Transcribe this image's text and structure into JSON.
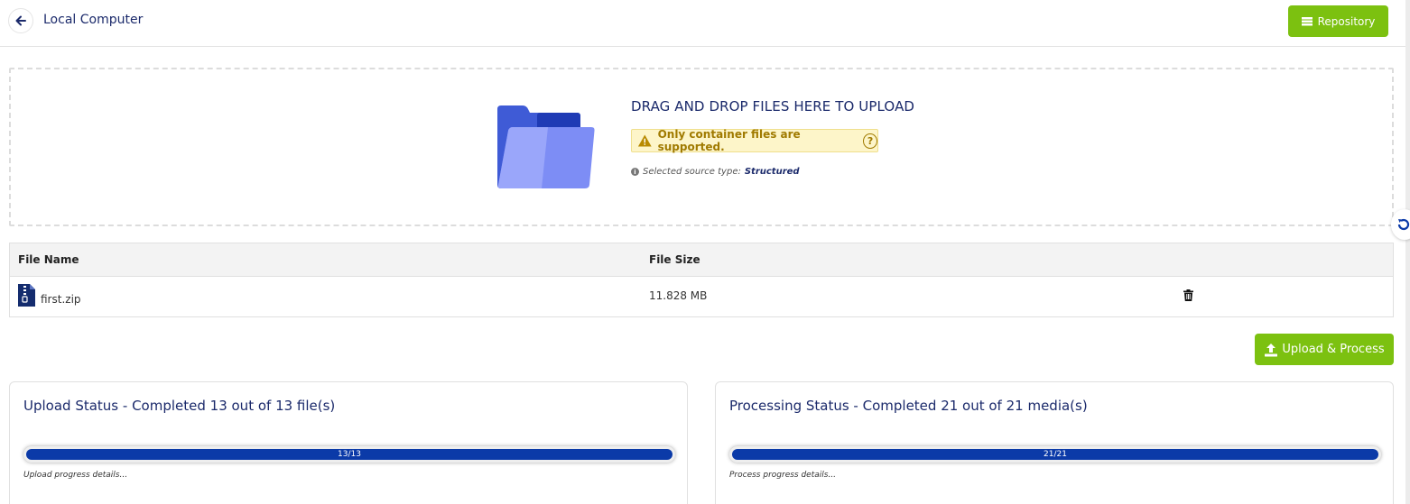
{
  "header": {
    "title": "Local Computer",
    "repository_label": "Repository"
  },
  "dropzone": {
    "title": "DRAG AND DROP FILES HERE TO UPLOAD",
    "warning": "Only container files are supported.",
    "source_prefix": "Selected source type:",
    "source_value": "Structured"
  },
  "files_table": {
    "columns": [
      "File Name",
      "File Size"
    ],
    "rows": [
      {
        "name": "first.zip",
        "size": "11.828 MB"
      }
    ]
  },
  "upload_button": "Upload & Process",
  "upload_status": {
    "title": "Upload Status - Completed 13 out of 13 file(s)",
    "progress_label": "13/13",
    "progress_fraction": 1.0,
    "detail": "Upload progress details..."
  },
  "processing_status": {
    "title": "Processing Status - Completed 21 out of 21 media(s)",
    "progress_label": "21/21",
    "progress_fraction": 1.0,
    "detail": "Process progress details..."
  },
  "colors": {
    "accent_green": "#7cc110",
    "navy": "#1b2a6b",
    "progress_blue": "#0b3aa8",
    "warning_bg": "#fdf5c9"
  },
  "icons": [
    "back-arrow-icon",
    "table-icon",
    "folder-icon",
    "warning-icon",
    "help-icon",
    "info-icon",
    "zip-file-icon",
    "trash-icon",
    "upload-icon",
    "refresh-icon"
  ]
}
